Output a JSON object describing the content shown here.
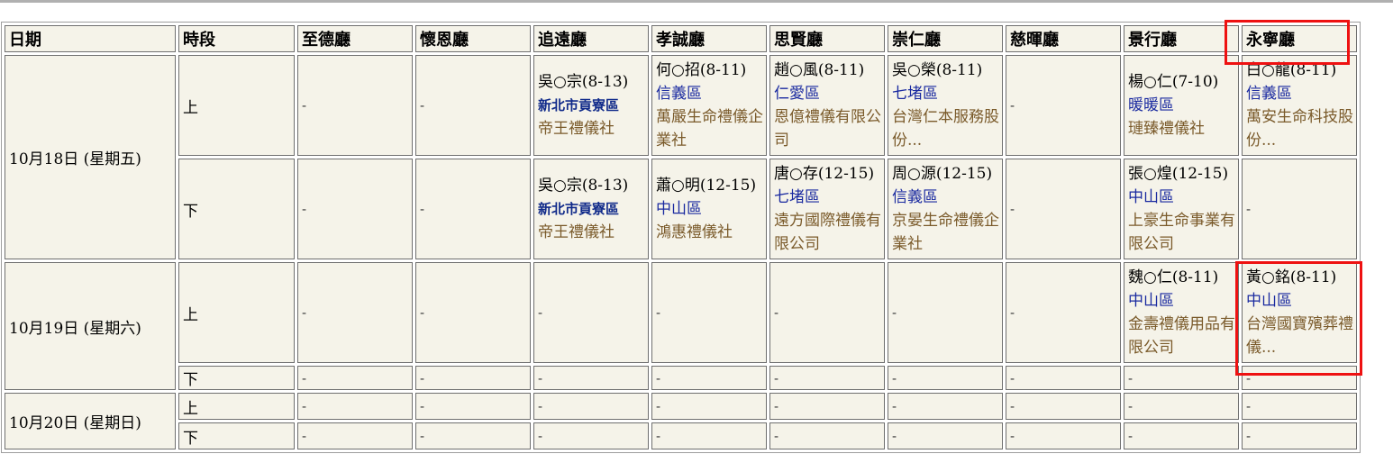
{
  "headers": [
    "日期",
    "時段",
    "至德廳",
    "懷恩廳",
    "追遠廳",
    "孝誠廳",
    "思賢廳",
    "崇仁廳",
    "慈暉廳",
    "景行廳",
    "永寧廳"
  ],
  "empty_mark": "-",
  "days": [
    {
      "date": "10月18日 (星期五)",
      "slots": [
        {
          "period": "上",
          "cells": [
            null,
            null,
            {
              "person": "吳○宗(8-13)",
              "district": "新北市貢寮區",
              "district_bold": true,
              "company": "帝王禮儀社"
            },
            {
              "person": "何○招(8-11)",
              "district": "信義區",
              "company": "萬嚴生命禮儀企業社"
            },
            {
              "person": "趙○風(8-11)",
              "district": "仁愛區",
              "company": "恩億禮儀有限公司"
            },
            {
              "person": "吳○榮(8-11)",
              "district": "七堵區",
              "company": "台灣仁本服務股份..."
            },
            null,
            {
              "person": "楊○仁(7-10)",
              "district": "暖暖區",
              "company": "璉臻禮儀社"
            },
            {
              "person": "白○龍(8-11)",
              "district": "信義區",
              "company": "萬安生命科技股份..."
            }
          ]
        },
        {
          "period": "下",
          "cells": [
            null,
            null,
            {
              "person": "吳○宗(8-13)",
              "district": "新北市貢寮區",
              "district_bold": true,
              "company": "帝王禮儀社"
            },
            {
              "person": "蕭○明(12-15)",
              "district": "中山區",
              "company": "鴻惠禮儀社"
            },
            {
              "person": "唐○存(12-15)",
              "district": "七堵區",
              "company": "遠方國際禮儀有限公司"
            },
            {
              "person": "周○源(12-15)",
              "district": "信義區",
              "company": "京晏生命禮儀企業社"
            },
            null,
            {
              "person": "張○煌(12-15)",
              "district": "中山區",
              "company": "上豪生命事業有限公司"
            },
            null
          ]
        }
      ]
    },
    {
      "date": "10月19日 (星期六)",
      "slots": [
        {
          "period": "上",
          "cells": [
            null,
            null,
            null,
            null,
            null,
            null,
            null,
            {
              "person": "魏○仁(8-11)",
              "district": "中山區",
              "company": "金壽禮儀用品有限公司"
            },
            {
              "person": "黃○銘(8-11)",
              "district": "中山區",
              "company": "台灣國寶殯葬禮儀..."
            }
          ]
        },
        {
          "period": "下",
          "cells": [
            null,
            null,
            null,
            null,
            null,
            null,
            null,
            null,
            null
          ]
        }
      ]
    },
    {
      "date": "10月20日 (星期日)",
      "slots": [
        {
          "period": "上",
          "cells": [
            null,
            null,
            null,
            null,
            null,
            null,
            null,
            null,
            null
          ]
        },
        {
          "period": "下",
          "cells": [
            null,
            null,
            null,
            null,
            null,
            null,
            null,
            null,
            null
          ]
        }
      ]
    }
  ]
}
